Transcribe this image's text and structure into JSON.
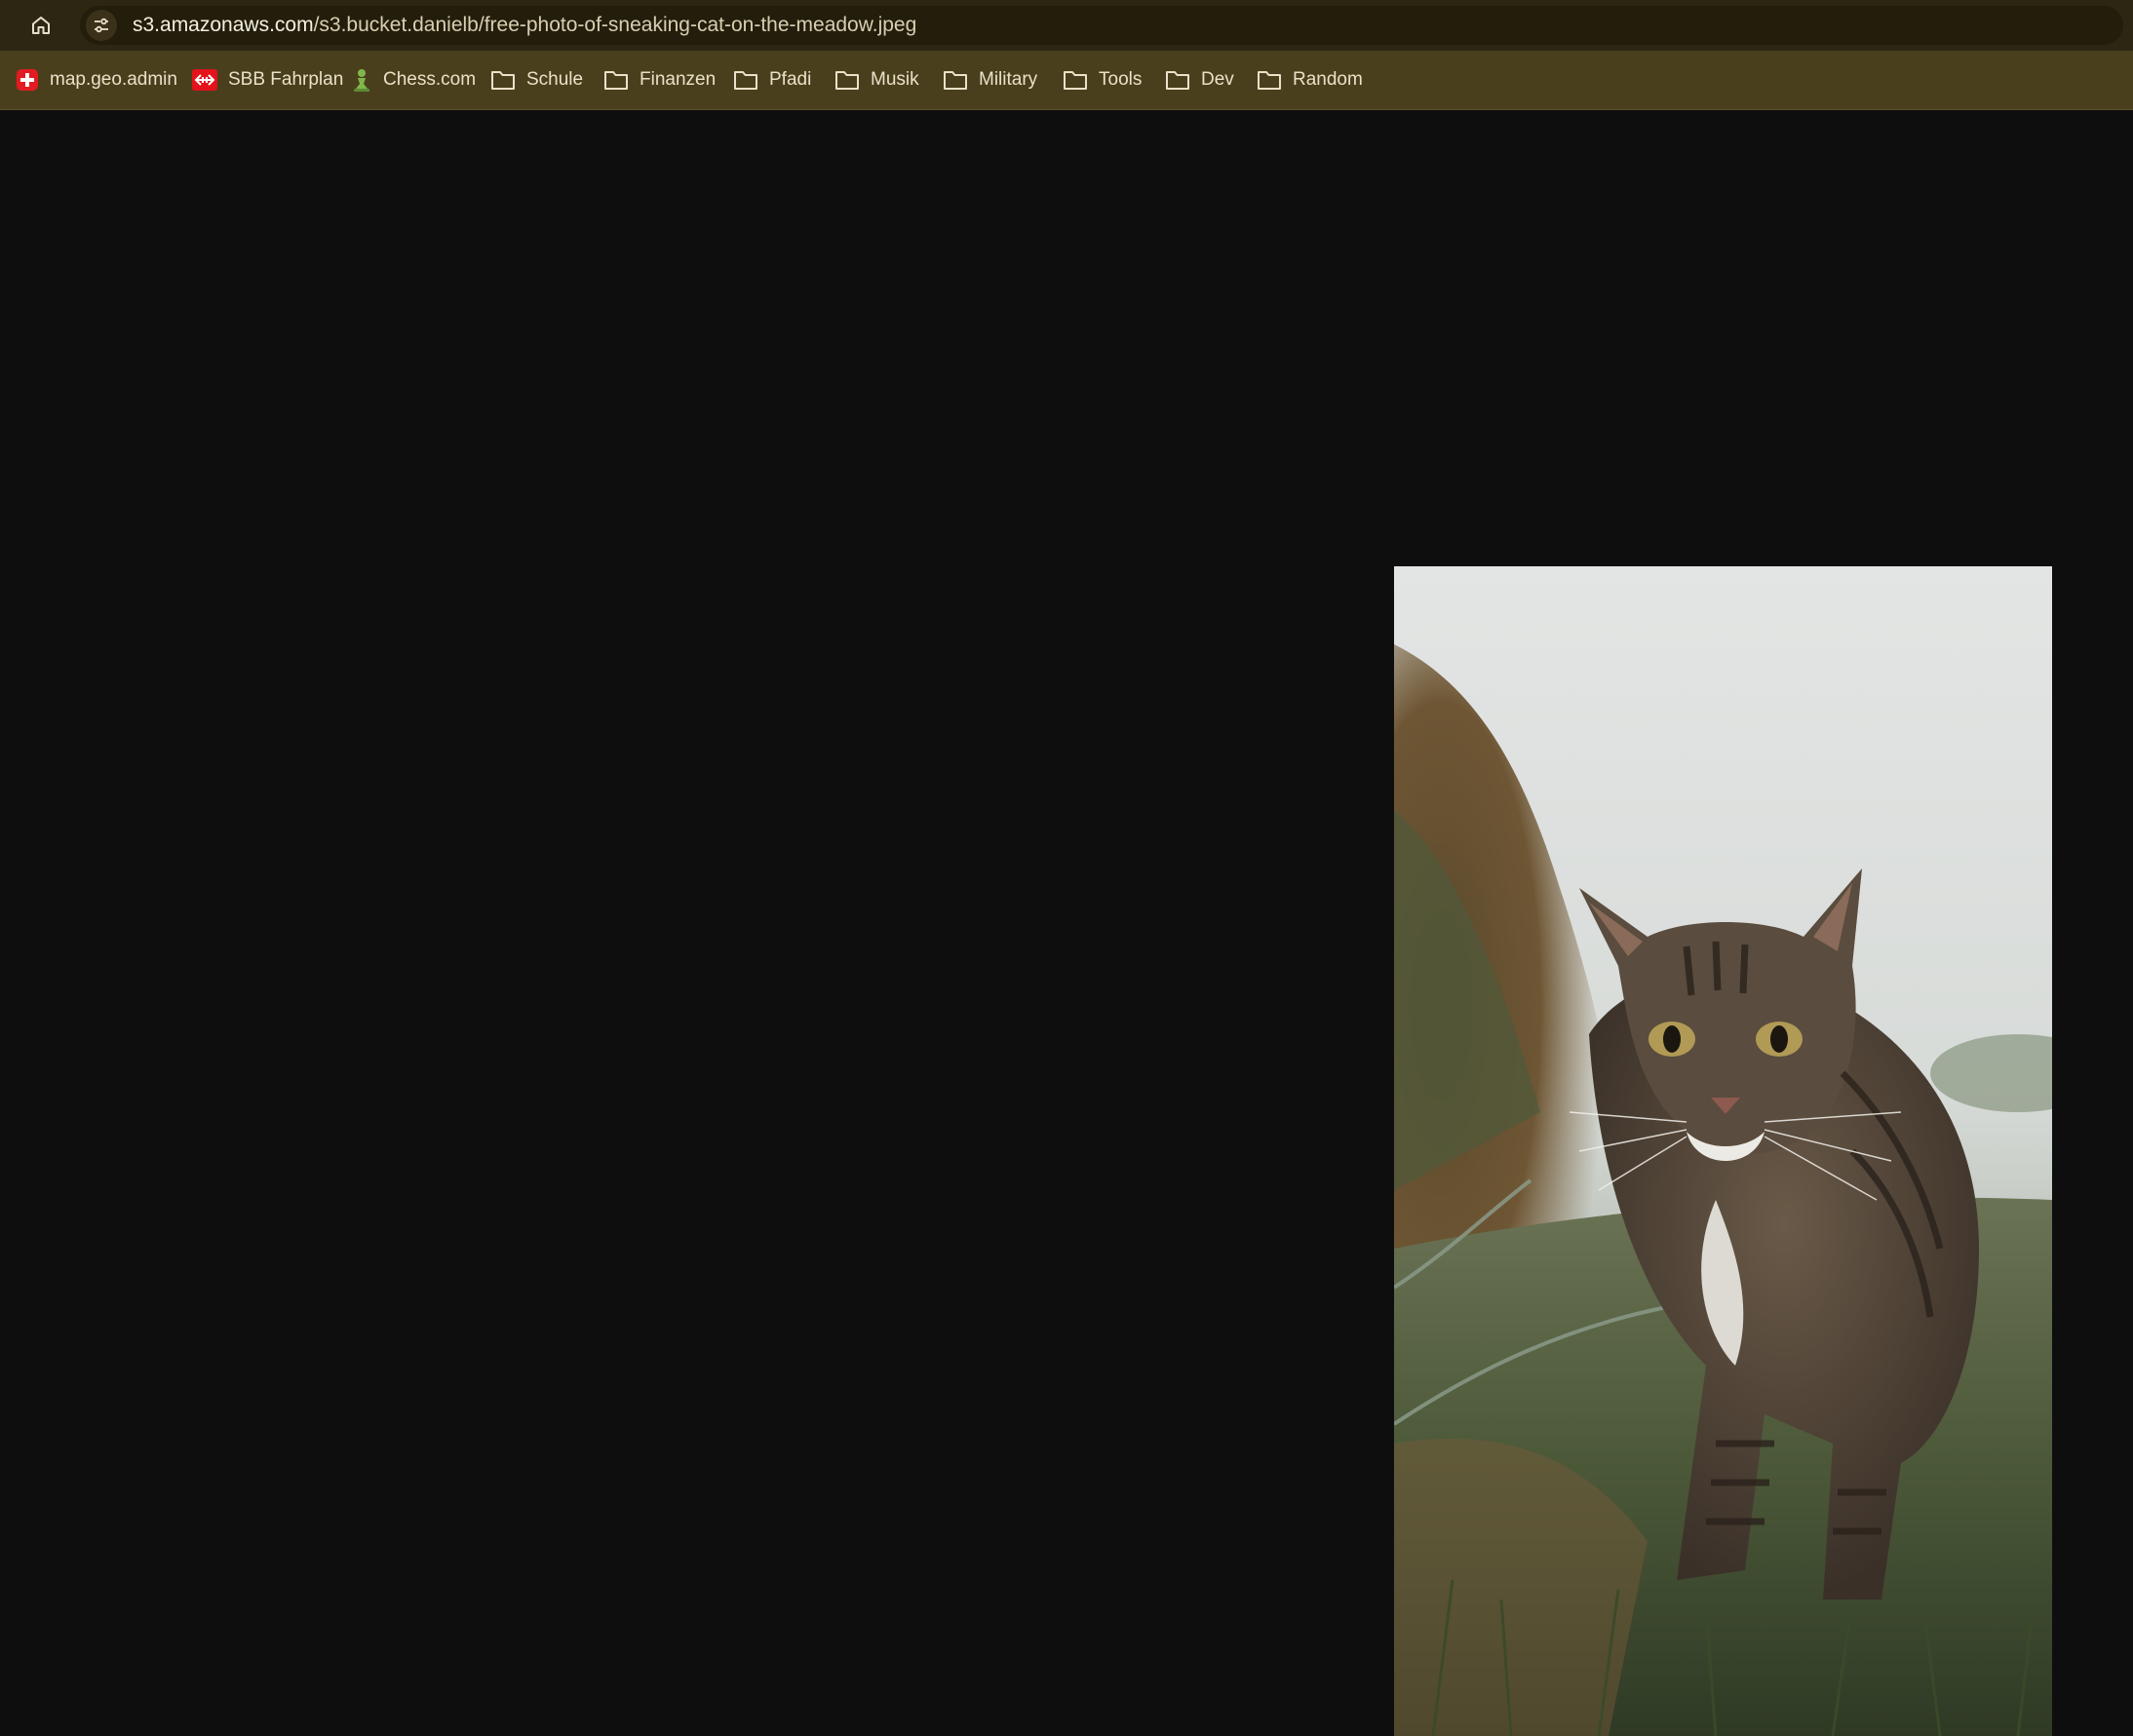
{
  "browser": {
    "url_host": "s3.amazonaws.com",
    "url_path": "/s3.bucket.danielb/free-photo-of-sneaking-cat-on-the-meadow.jpeg",
    "theme_colors": {
      "toolbar": "#2d2612",
      "bookmarks_bar": "#4a3f1d",
      "page_background": "#0e0e0f"
    }
  },
  "bookmarks": [
    {
      "label": "map.geo.admin",
      "icon": "swiss-flag-icon"
    },
    {
      "label": "SBB Fahrplan",
      "icon": "sbb-logo-icon"
    },
    {
      "label": "Chess.com",
      "icon": "chess-pawn-icon"
    },
    {
      "label": "Schule",
      "icon": "folder-icon"
    },
    {
      "label": "Finanzen",
      "icon": "folder-icon"
    },
    {
      "label": "Pfadi",
      "icon": "folder-icon"
    },
    {
      "label": "Musik",
      "icon": "folder-icon"
    },
    {
      "label": "Military",
      "icon": "folder-icon"
    },
    {
      "label": "Tools",
      "icon": "folder-icon"
    },
    {
      "label": "Dev",
      "icon": "folder-icon"
    },
    {
      "label": "Random",
      "icon": "folder-icon"
    }
  ],
  "image": {
    "subject": "tabby cat walking through meadow grass"
  }
}
